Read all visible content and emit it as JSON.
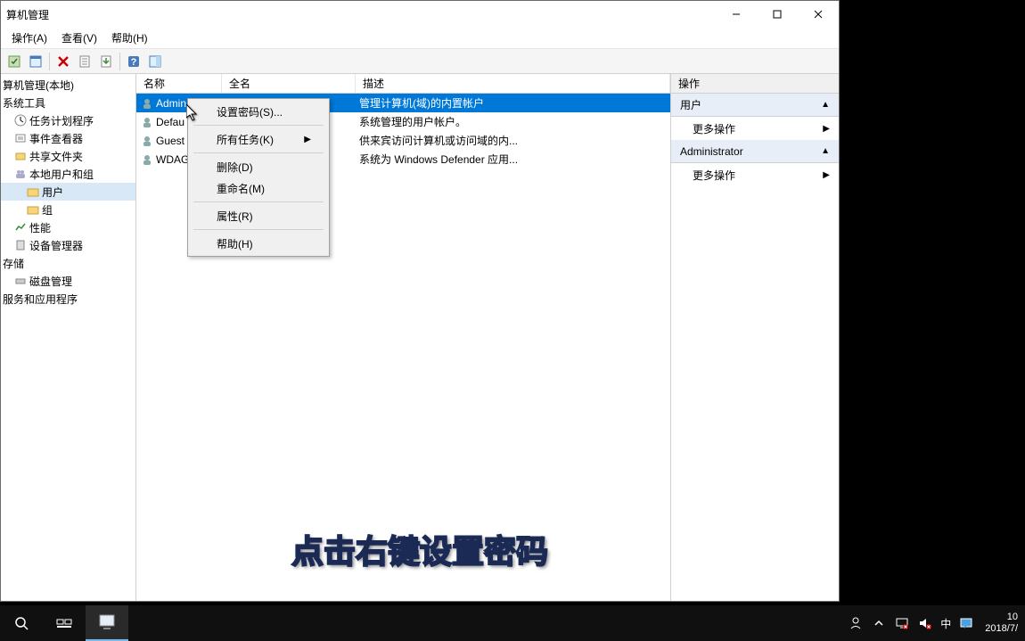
{
  "window": {
    "title": "算机管理"
  },
  "menubar": {
    "items": [
      "操作(A)",
      "查看(V)",
      "帮助(H)"
    ]
  },
  "tree": {
    "root": "算机管理(本地)",
    "group1": "系统工具",
    "items1": [
      "任务计划程序",
      "事件查看器",
      "共享文件夹"
    ],
    "local_users": "本地用户和组",
    "users": "用户",
    "groups": "组",
    "perf": "性能",
    "devmgr": "设备管理器",
    "group2": "存储",
    "diskmgr": "磁盘管理",
    "group3": "服务和应用程序"
  },
  "columns": {
    "c1": "名称",
    "c2": "全名",
    "c3": "描述"
  },
  "users": [
    {
      "name": "Admin",
      "full": "",
      "desc": "管理计算机(域)的内置帐户",
      "selected": true
    },
    {
      "name": "Defau",
      "full": "",
      "desc": "系统管理的用户帐户。",
      "selected": false
    },
    {
      "name": "Guest",
      "full": "",
      "desc": "供来宾访问计算机或访问域的内...",
      "selected": false
    },
    {
      "name": "WDAG",
      "full": "",
      "desc": "系统为 Windows Defender 应用...",
      "selected": false
    }
  ],
  "context_menu": {
    "set_password": "设置密码(S)...",
    "all_tasks": "所有任务(K)",
    "delete": "删除(D)",
    "rename": "重命名(M)",
    "properties": "属性(R)",
    "help": "帮助(H)"
  },
  "actions": {
    "header": "操作",
    "section1": "用户",
    "more1": "更多操作",
    "section2": "Administrator",
    "more2": "更多操作"
  },
  "caption": "点击右键设置密码",
  "clock": {
    "time": "10",
    "date": "2018/7/"
  }
}
